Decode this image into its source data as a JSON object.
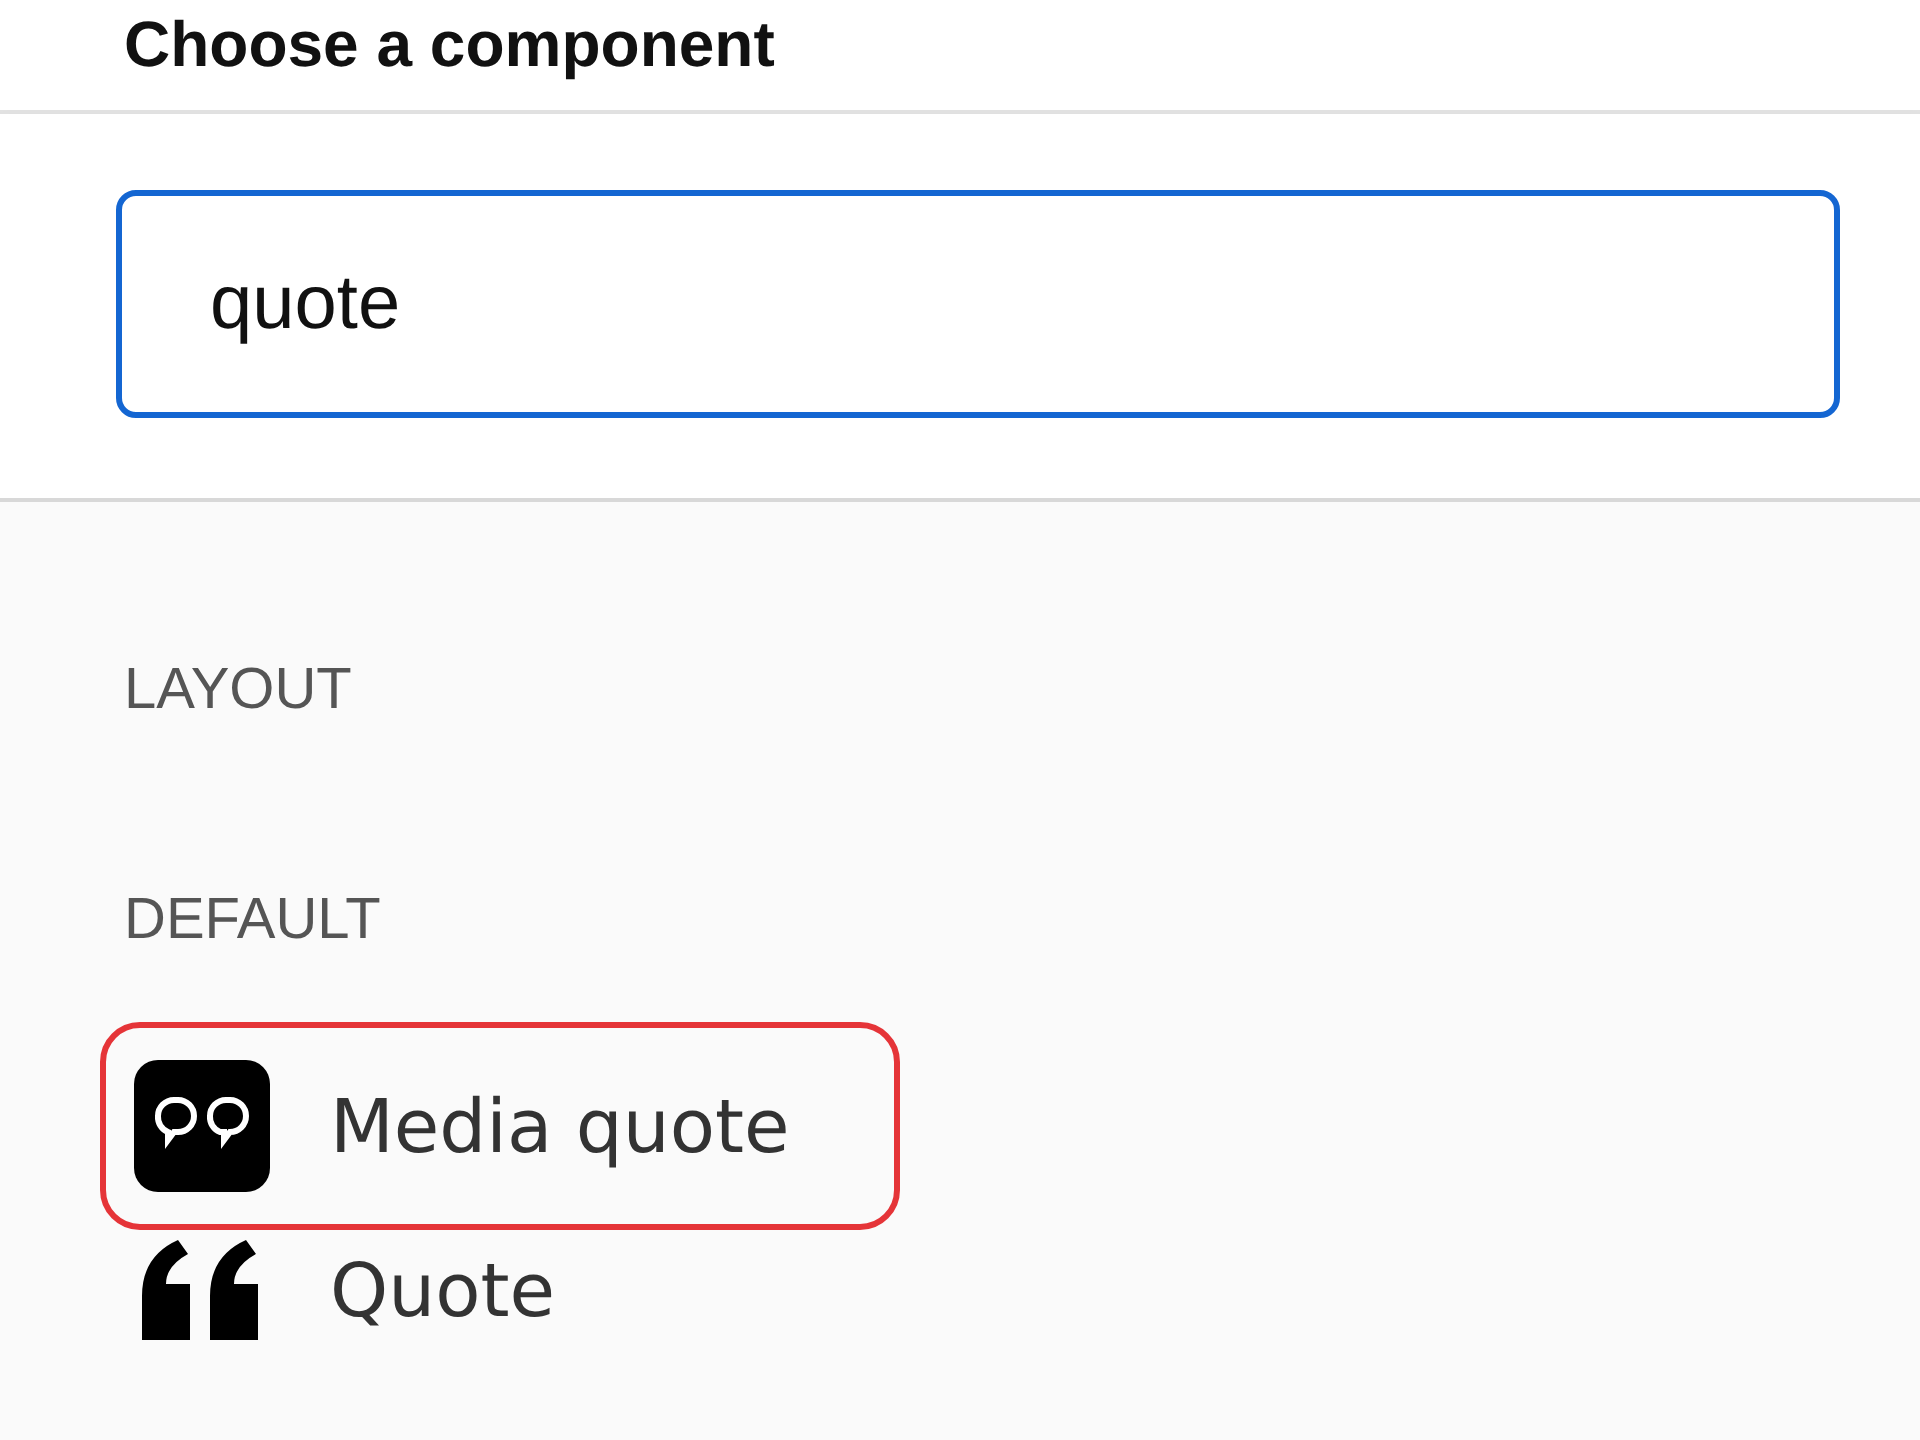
{
  "title": "Choose a component",
  "search": {
    "value": "quote",
    "focused": true
  },
  "sections": [
    {
      "heading": "LAYOUT"
    },
    {
      "heading": "DEFAULT",
      "items": [
        {
          "kind": "media-quote",
          "label": "Media quote",
          "highlighted": true
        },
        {
          "kind": "quote",
          "label": "Quote",
          "highlighted": false
        }
      ]
    }
  ]
}
